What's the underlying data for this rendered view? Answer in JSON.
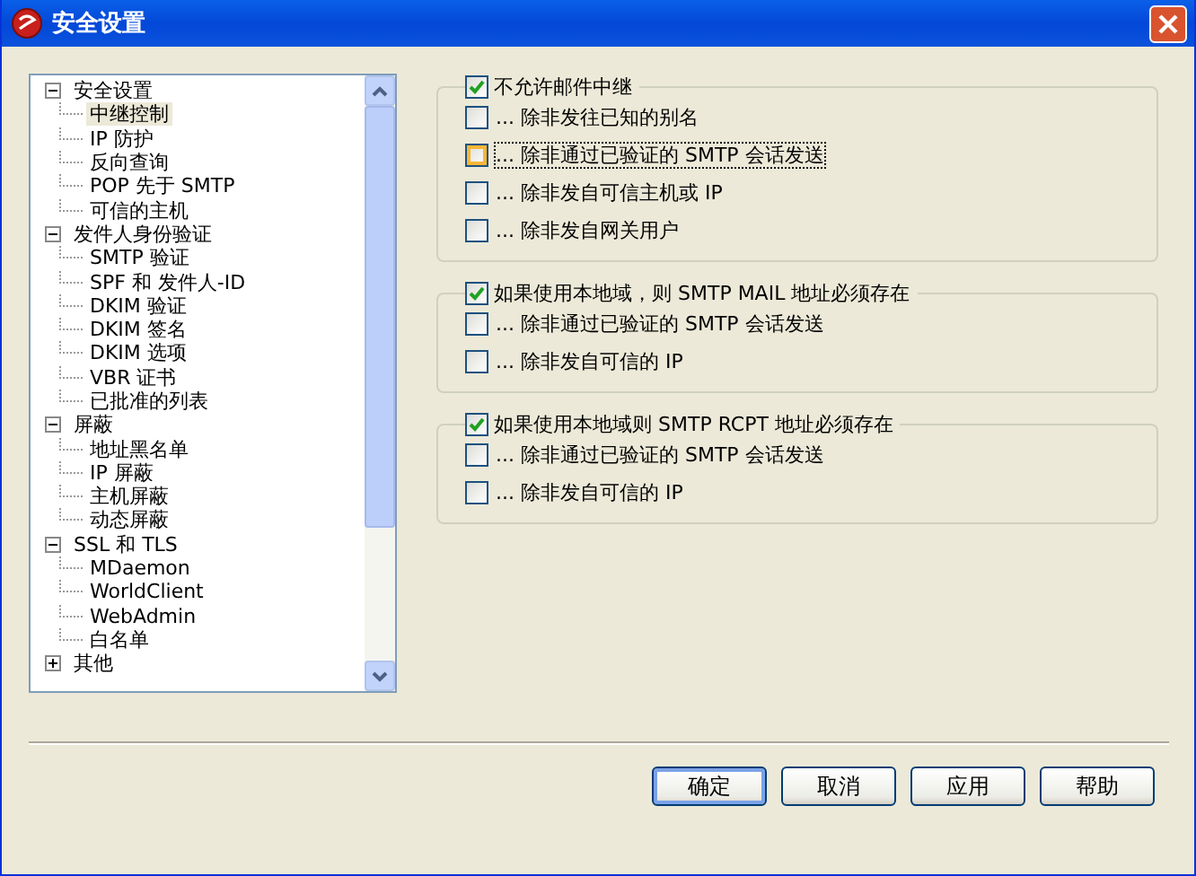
{
  "window": {
    "title": "安全设置"
  },
  "tree": [
    {
      "label": "安全设置",
      "expanded": true,
      "children": [
        {
          "label": "中继控制",
          "selected": true
        },
        {
          "label": "IP 防护",
          "selected": false
        },
        {
          "label": "反向查询",
          "selected": false
        },
        {
          "label": "POP 先于 SMTP",
          "selected": false
        },
        {
          "label": "可信的主机",
          "selected": false
        }
      ]
    },
    {
      "label": "发件人身份验证",
      "expanded": true,
      "children": [
        {
          "label": "SMTP 验证",
          "selected": false
        },
        {
          "label": "SPF 和 发件人-ID",
          "selected": false
        },
        {
          "label": "DKIM 验证",
          "selected": false
        },
        {
          "label": "DKIM 签名",
          "selected": false
        },
        {
          "label": "DKIM 选项",
          "selected": false
        },
        {
          "label": "VBR 证书",
          "selected": false
        },
        {
          "label": "已批准的列表",
          "selected": false
        }
      ]
    },
    {
      "label": "屏蔽",
      "expanded": true,
      "children": [
        {
          "label": "地址黑名单",
          "selected": false
        },
        {
          "label": "IP 屏蔽",
          "selected": false
        },
        {
          "label": "主机屏蔽",
          "selected": false
        },
        {
          "label": "动态屏蔽",
          "selected": false
        }
      ]
    },
    {
      "label": "SSL 和 TLS",
      "expanded": true,
      "children": [
        {
          "label": "MDaemon",
          "selected": false
        },
        {
          "label": "WorldClient",
          "selected": false
        },
        {
          "label": "WebAdmin",
          "selected": false
        },
        {
          "label": "白名单",
          "selected": false
        }
      ]
    },
    {
      "label": "其他",
      "expanded": false
    }
  ],
  "groups": [
    {
      "label": "不允许邮件中继",
      "checked": true,
      "options": [
        {
          "label": "... 除非发往已知的别名",
          "checked": false,
          "focused": false
        },
        {
          "label": "... 除非通过已验证的 SMTP 会话发送",
          "checked": false,
          "focused": true
        },
        {
          "label": "... 除非发自可信主机或 IP",
          "checked": false,
          "focused": false
        },
        {
          "label": "... 除非发自网关用户",
          "checked": false,
          "focused": false
        }
      ]
    },
    {
      "label": "如果使用本地域，则 SMTP MAIL 地址必须存在",
      "checked": true,
      "options": [
        {
          "label": "... 除非通过已验证的 SMTP 会话发送",
          "checked": false,
          "focused": false
        },
        {
          "label": "... 除非发自可信的 IP",
          "checked": false,
          "focused": false
        }
      ]
    },
    {
      "label": "如果使用本地域则 SMTP RCPT 地址必须存在",
      "checked": true,
      "options": [
        {
          "label": "... 除非通过已验证的 SMTP 会话发送",
          "checked": false,
          "focused": false
        },
        {
          "label": "... 除非发自可信的 IP",
          "checked": false,
          "focused": false
        }
      ]
    }
  ],
  "buttons": [
    {
      "label": "确定",
      "default": true
    },
    {
      "label": "取消",
      "default": false
    },
    {
      "label": "应用",
      "default": false
    },
    {
      "label": "帮助",
      "default": false
    }
  ]
}
